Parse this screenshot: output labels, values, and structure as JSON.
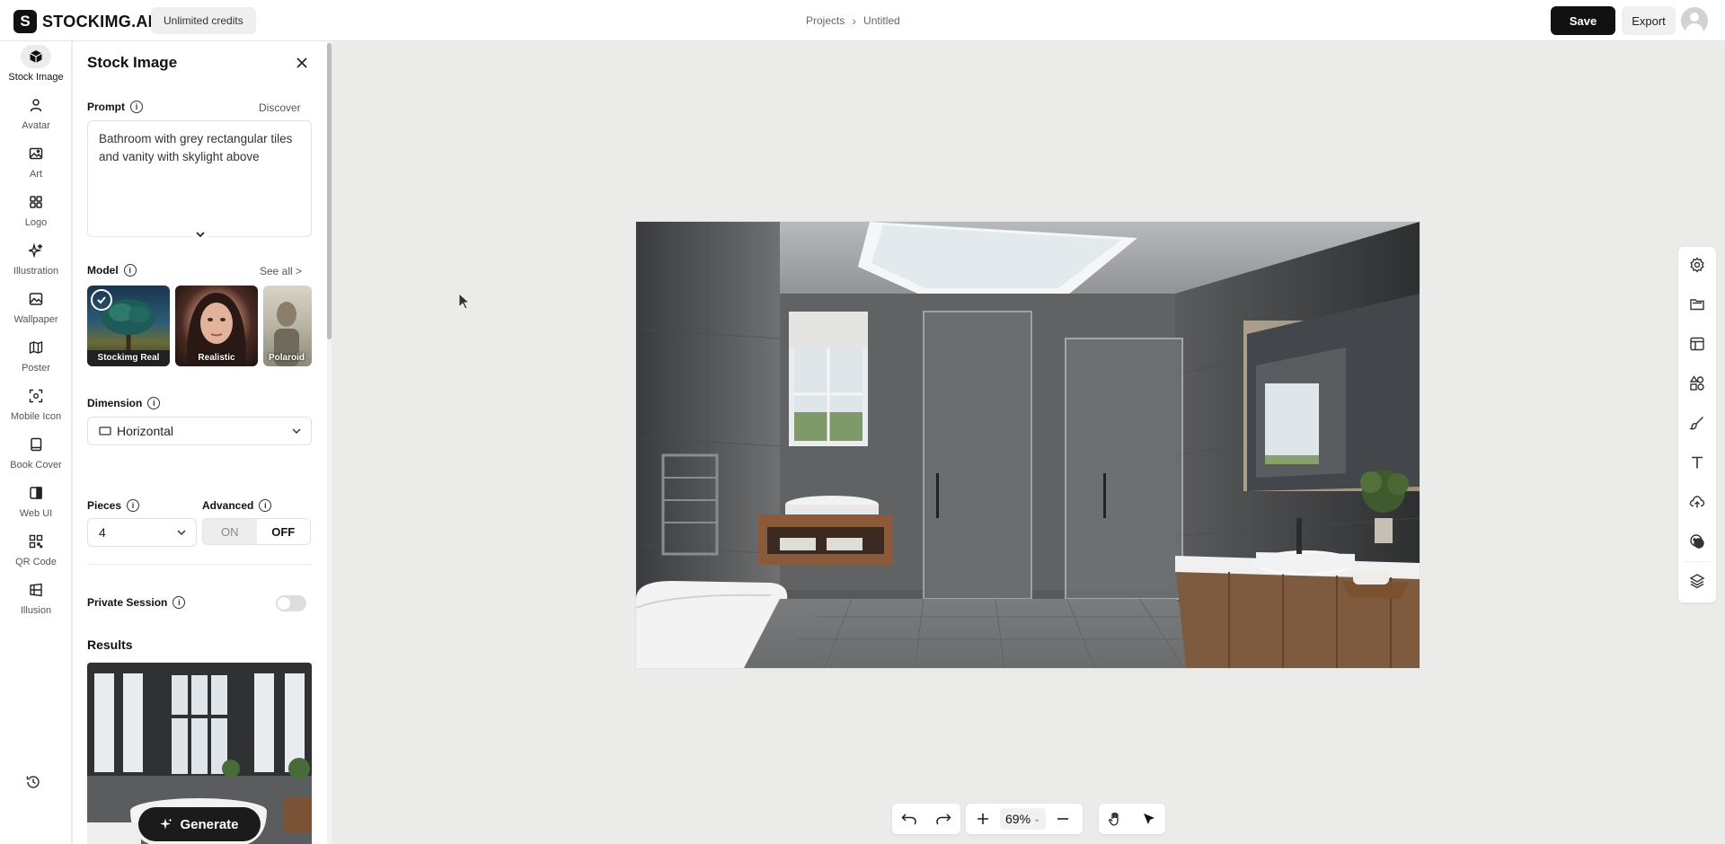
{
  "brand": {
    "name": "STOCKIMG.AI",
    "mark": "S"
  },
  "credits_label": "Unlimited credits",
  "breadcrumb": {
    "projects": "Projects",
    "separator": "›",
    "current": "Untitled"
  },
  "header": {
    "save_label": "Save",
    "export_label": "Export"
  },
  "rail": {
    "items": [
      {
        "label": "Stock Image",
        "icon": "cube-icon",
        "active": true
      },
      {
        "label": "Avatar",
        "icon": "person-icon"
      },
      {
        "label": "Art",
        "icon": "image-icon"
      },
      {
        "label": "Logo",
        "icon": "grid-icon"
      },
      {
        "label": "Illustration",
        "icon": "sparkle-icon"
      },
      {
        "label": "Wallpaper",
        "icon": "wallpaper-icon"
      },
      {
        "label": "Poster",
        "icon": "map-icon"
      },
      {
        "label": "Mobile Icon",
        "icon": "focus-icon"
      },
      {
        "label": "Book Cover",
        "icon": "book-icon"
      },
      {
        "label": "Web UI",
        "icon": "layout-icon"
      },
      {
        "label": "QR Code",
        "icon": "qr-icon"
      },
      {
        "label": "Illusion",
        "icon": "illusion-icon"
      }
    ],
    "history_icon": "history-icon"
  },
  "panel": {
    "title": "Stock Image",
    "prompt_label": "Prompt",
    "discover_label": "Discover",
    "prompt_text": "Bathroom with grey rectangular tiles and vanity with skylight above",
    "model_label": "Model",
    "see_all_label": "See all >",
    "models": [
      {
        "name": "Stockimg Real",
        "selected": true
      },
      {
        "name": "Realistic",
        "selected": false
      },
      {
        "name": "Polaroid",
        "selected": false
      }
    ],
    "dimension_label": "Dimension",
    "dimension_value": "Horizontal",
    "pieces_label": "Pieces",
    "pieces_value": "4",
    "advanced_label": "Advanced",
    "advanced_on": "ON",
    "advanced_off": "OFF",
    "advanced_selected": "OFF",
    "private_session_label": "Private Session",
    "private_session_enabled": false,
    "results_label": "Results",
    "generate_label": "Generate"
  },
  "canvas": {
    "image_subject": "bathroom-render"
  },
  "right_toolbar": [
    "settings-icon",
    "folder-icon",
    "template-icon",
    "shapes-icon",
    "brush-icon",
    "text-icon",
    "upload-cloud-icon",
    "sticker-icon",
    "layers-icon"
  ],
  "bottom_toolbar": {
    "zoom_value": "69%",
    "zoom_caret": "⌄"
  },
  "colors": {
    "accent": "#111111",
    "background": "#ebebea",
    "panel": "#ffffff"
  }
}
